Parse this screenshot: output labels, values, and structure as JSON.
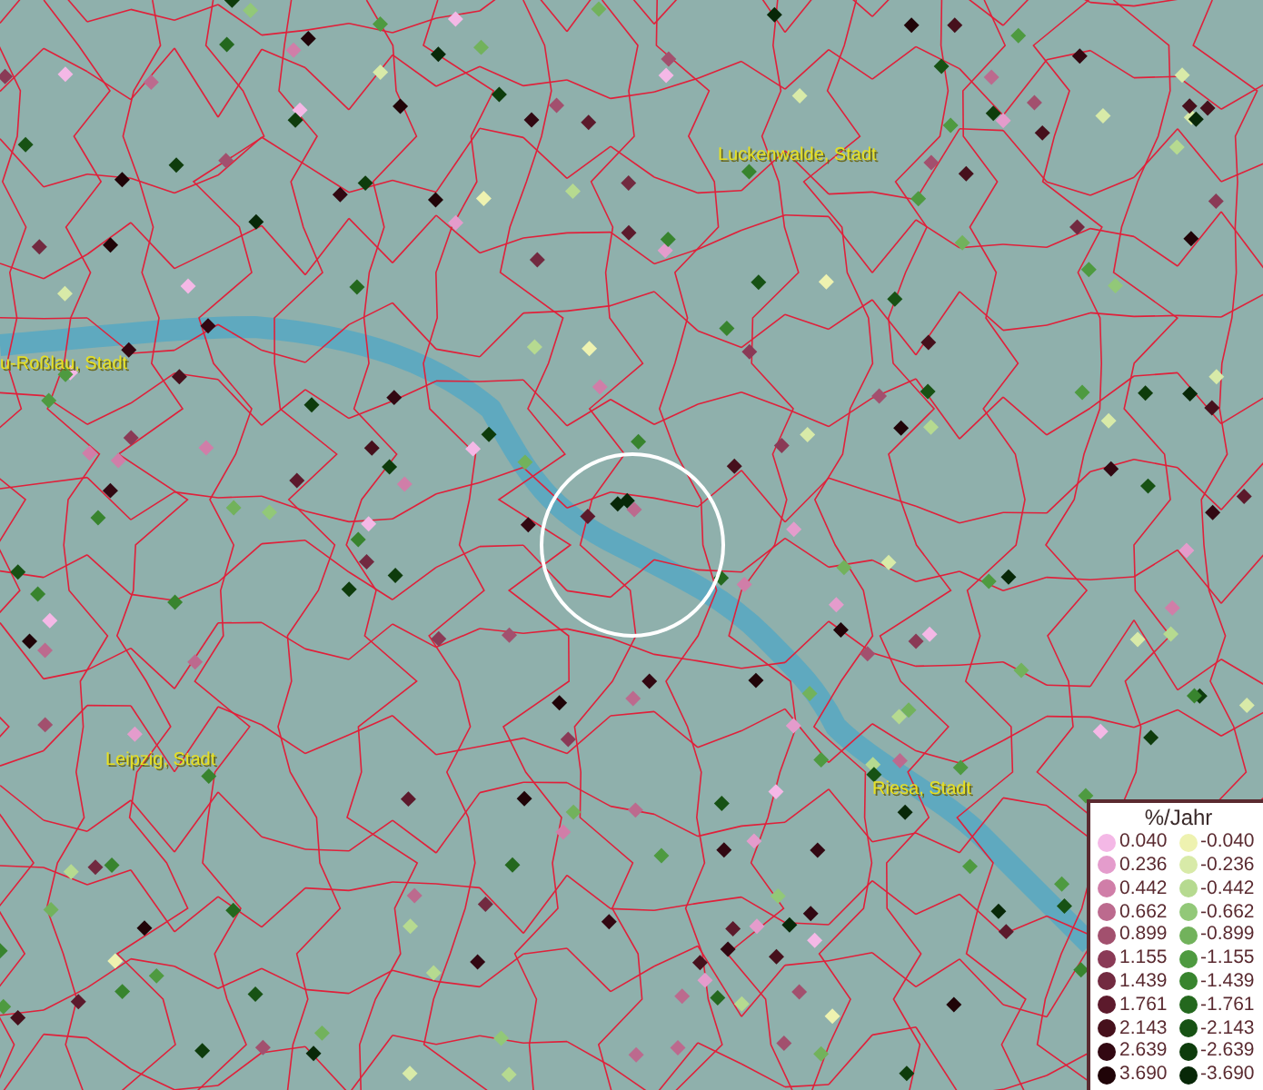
{
  "map": {
    "places": [
      {
        "name": "Luckenwalde, Stadt"
      },
      {
        "name": "u-Roßlau, Stadt"
      },
      {
        "name": "Leipzig, Stadt"
      },
      {
        "name": "Riesa, Stadt"
      }
    ]
  },
  "legend": {
    "title": "%/Jahr",
    "entries": [
      {
        "value": "0.040",
        "color": "#f4b8e6"
      },
      {
        "value": "-0.040",
        "color": "#eef2b0"
      },
      {
        "value": "0.236",
        "color": "#e49ccc"
      },
      {
        "value": "-0.236",
        "color": "#d8eaa8"
      },
      {
        "value": "0.442",
        "color": "#d07ea8"
      },
      {
        "value": "-0.442",
        "color": "#b6da90"
      },
      {
        "value": "0.662",
        "color": "#bc6a8e"
      },
      {
        "value": "-0.662",
        "color": "#92c878"
      },
      {
        "value": "0.899",
        "color": "#a2506e"
      },
      {
        "value": "-0.899",
        "color": "#72b25c"
      },
      {
        "value": "1.155",
        "color": "#8a3a56"
      },
      {
        "value": "-1.155",
        "color": "#4e9a40"
      },
      {
        "value": "1.439",
        "color": "#722a40"
      },
      {
        "value": "-1.439",
        "color": "#38842e"
      },
      {
        "value": "1.761",
        "color": "#5c1a2c"
      },
      {
        "value": "-1.761",
        "color": "#24681e"
      },
      {
        "value": "2.143",
        "color": "#46101c"
      },
      {
        "value": "-2.143",
        "color": "#175214"
      },
      {
        "value": "2.639",
        "color": "#320812"
      },
      {
        "value": "-2.639",
        "color": "#0e3c0c"
      },
      {
        "value": "3.690",
        "color": "#200408"
      },
      {
        "value": "-3.690",
        "color": "#082808"
      }
    ]
  }
}
